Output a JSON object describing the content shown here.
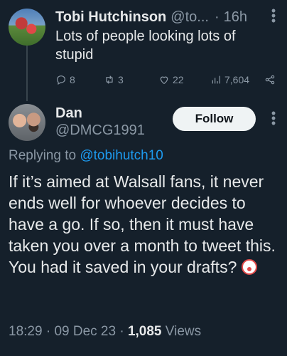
{
  "parent": {
    "name": "Tobi Hutchinson",
    "handle": "@to...",
    "separator": "·",
    "time": "16h",
    "text": "Lots of people looking lots of stupid",
    "replies": "8",
    "retweets": "3",
    "likes": "22",
    "views": "7,604"
  },
  "reply": {
    "name": "Dan",
    "handle": "@DMCG1991",
    "follow_label": "Follow",
    "replying_prefix": "Replying to ",
    "replying_to": "@tobihutch10",
    "text": "If it’s aimed at Walsall fans, it never ends well for whoever decides to have a go. If so, then it must have taken you over a month to tweet this. You had it saved in your drafts?",
    "emoji_icon": "clown-face-emoji",
    "time": "18:29",
    "date_separator": " · ",
    "date": "09 Dec 23",
    "views_separator": " · ",
    "views_count": "1,085",
    "views_label": " Views"
  },
  "colors": {
    "background": "#15202b",
    "text": "#e7e9ea",
    "muted": "#8b98a5",
    "link": "#1d9bf0"
  }
}
